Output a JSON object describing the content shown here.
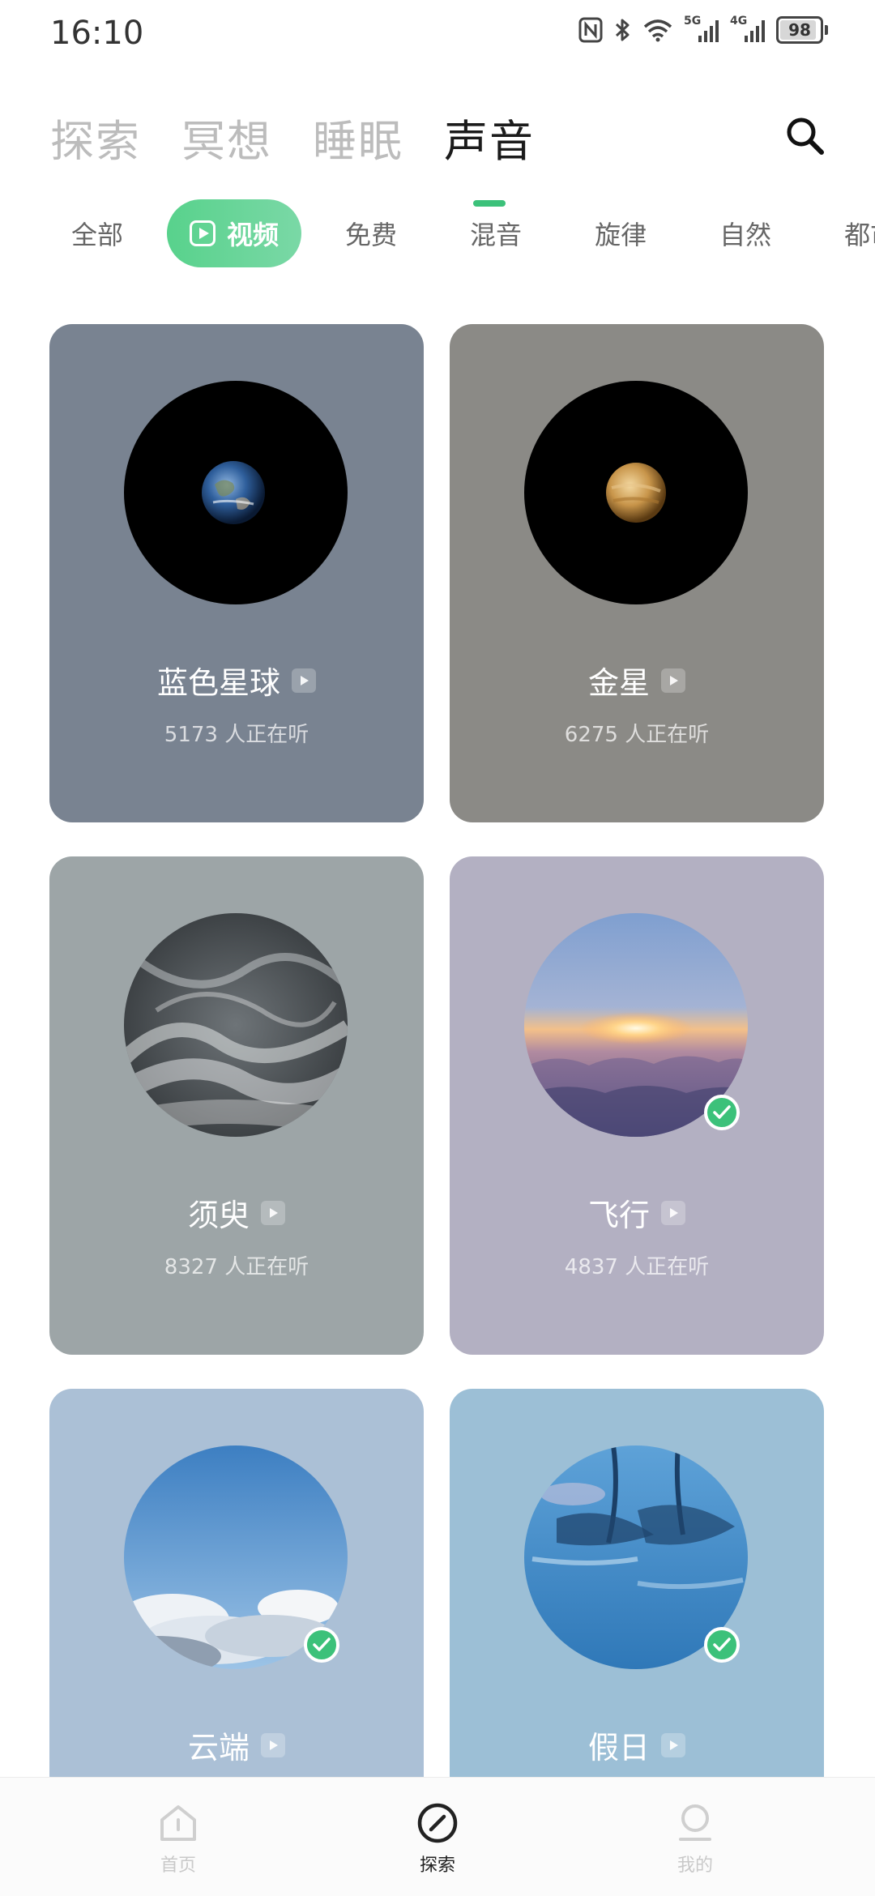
{
  "status_bar": {
    "time": "16:10",
    "network_5g": "5G",
    "network_4g": "4G",
    "battery": "98"
  },
  "top_tabs": [
    {
      "label": "探索",
      "active": false
    },
    {
      "label": "冥想",
      "active": false
    },
    {
      "label": "睡眠",
      "active": false
    },
    {
      "label": "声音",
      "active": true
    }
  ],
  "chips": [
    {
      "label": "全部",
      "active": false
    },
    {
      "label": "视频",
      "active": true
    },
    {
      "label": "免费",
      "active": false
    },
    {
      "label": "混音",
      "active": false
    },
    {
      "label": "旋律",
      "active": false
    },
    {
      "label": "自然",
      "active": false
    },
    {
      "label": "都市",
      "active": false
    }
  ],
  "cards": [
    {
      "title": "蓝色星球",
      "listeners": "5173 人正在听",
      "bg": "#798391",
      "art": "earth",
      "checked": false
    },
    {
      "title": "金星",
      "listeners": "6275 人正在听",
      "bg": "#8b8a86",
      "art": "venus",
      "checked": false
    },
    {
      "title": "须臾",
      "listeners": "8327 人正在听",
      "bg": "#9da5a7",
      "art": "smoke",
      "checked": false
    },
    {
      "title": "飞行",
      "listeners": "4837 人正在听",
      "bg": "#b3b0c2",
      "art": "sunrise",
      "checked": true
    },
    {
      "title": "云端",
      "listeners": "",
      "bg": "#abc0d6",
      "art": "clouds",
      "checked": true
    },
    {
      "title": "假日",
      "listeners": "",
      "bg": "#9cbfd6",
      "art": "palms",
      "checked": true
    }
  ],
  "bottom_nav": [
    {
      "label": "首页",
      "icon": "home-icon",
      "active": false
    },
    {
      "label": "探索",
      "icon": "compass-icon",
      "active": true
    },
    {
      "label": "我的",
      "icon": "profile-icon",
      "active": false
    }
  ],
  "colors": {
    "accent": "#3cc17a"
  }
}
